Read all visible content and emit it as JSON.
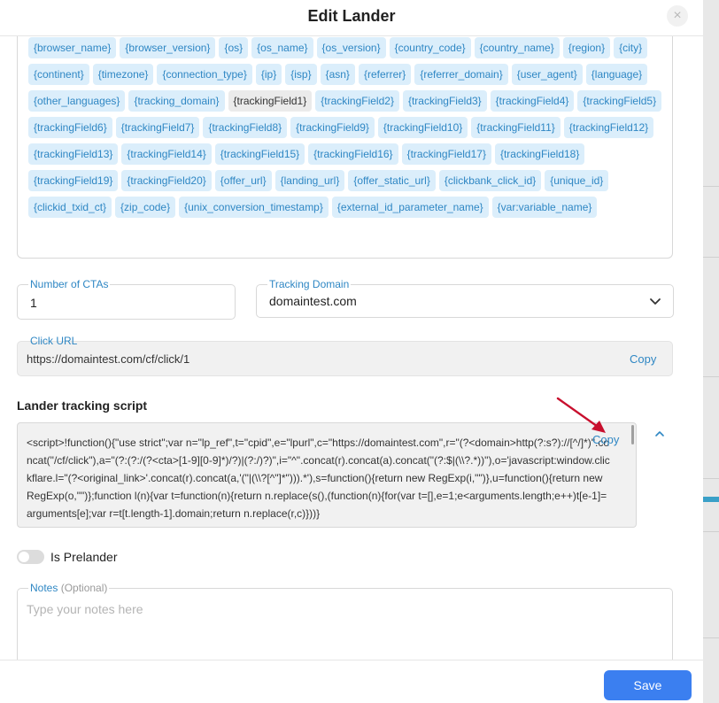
{
  "modal": {
    "title": "Edit Lander",
    "close_icon": "×"
  },
  "tokens": [
    {
      "label": "{browser_name}",
      "selected": false
    },
    {
      "label": "{browser_version}",
      "selected": false
    },
    {
      "label": "{os}",
      "selected": false
    },
    {
      "label": "{os_name}",
      "selected": false
    },
    {
      "label": "{os_version}",
      "selected": false
    },
    {
      "label": "{country_code}",
      "selected": false
    },
    {
      "label": "{country_name}",
      "selected": false
    },
    {
      "label": "{region}",
      "selected": false
    },
    {
      "label": "{city}",
      "selected": false
    },
    {
      "label": "{continent}",
      "selected": false
    },
    {
      "label": "{timezone}",
      "selected": false
    },
    {
      "label": "{connection_type}",
      "selected": false
    },
    {
      "label": "{ip}",
      "selected": false
    },
    {
      "label": "{isp}",
      "selected": false
    },
    {
      "label": "{asn}",
      "selected": false
    },
    {
      "label": "{referrer}",
      "selected": false
    },
    {
      "label": "{referrer_domain}",
      "selected": false
    },
    {
      "label": "{user_agent}",
      "selected": false
    },
    {
      "label": "{language}",
      "selected": false
    },
    {
      "label": "{other_languages}",
      "selected": false
    },
    {
      "label": "{tracking_domain}",
      "selected": false
    },
    {
      "label": "{trackingField1}",
      "selected": true
    },
    {
      "label": "{trackingField2}",
      "selected": false
    },
    {
      "label": "{trackingField3}",
      "selected": false
    },
    {
      "label": "{trackingField4}",
      "selected": false
    },
    {
      "label": "{trackingField5}",
      "selected": false
    },
    {
      "label": "{trackingField6}",
      "selected": false
    },
    {
      "label": "{trackingField7}",
      "selected": false
    },
    {
      "label": "{trackingField8}",
      "selected": false
    },
    {
      "label": "{trackingField9}",
      "selected": false
    },
    {
      "label": "{trackingField10}",
      "selected": false
    },
    {
      "label": "{trackingField11}",
      "selected": false
    },
    {
      "label": "{trackingField12}",
      "selected": false
    },
    {
      "label": "{trackingField13}",
      "selected": false
    },
    {
      "label": "{trackingField14}",
      "selected": false
    },
    {
      "label": "{trackingField15}",
      "selected": false
    },
    {
      "label": "{trackingField16}",
      "selected": false
    },
    {
      "label": "{trackingField17}",
      "selected": false
    },
    {
      "label": "{trackingField18}",
      "selected": false
    },
    {
      "label": "{trackingField19}",
      "selected": false
    },
    {
      "label": "{trackingField20}",
      "selected": false
    },
    {
      "label": "{offer_url}",
      "selected": false
    },
    {
      "label": "{landing_url}",
      "selected": false
    },
    {
      "label": "{offer_static_url}",
      "selected": false
    },
    {
      "label": "{clickbank_click_id}",
      "selected": false
    },
    {
      "label": "{unique_id}",
      "selected": false
    },
    {
      "label": "{clickid_txid_ct}",
      "selected": false
    },
    {
      "label": "{zip_code}",
      "selected": false
    },
    {
      "label": "{unix_conversion_timestamp}",
      "selected": false
    },
    {
      "label": "{external_id_parameter_name}",
      "selected": false
    },
    {
      "label": "{var:variable_name}",
      "selected": false
    }
  ],
  "ctas": {
    "label": "Number of CTAs",
    "value": "1"
  },
  "tracking_domain": {
    "label": "Tracking Domain",
    "value": "domaintest.com",
    "icon": "chevron-down-icon"
  },
  "click_url": {
    "label": "Click URL",
    "value": "https://domaintest.com/cf/click/1",
    "copy_label": "Copy"
  },
  "script": {
    "title": "Lander tracking script",
    "copy_label": "Copy",
    "text": "<script>!function(){\"use strict\";var n=\"lp_ref\",t=\"cpid\",e=\"lpurl\",c=\"https://domaintest.com\",r=\"(?<domain>http(?:s?)://[^/]*)\".concat(\"/cf/click\"),a=\"(?:(?:/(?<cta>[1-9][0-9]*)/?)|(?:/)?)\",i=\"^\".concat(r).concat(a).concat(\"(?:$|(\\\\?.*))\"),o='javascript:window.clickflare.l=\"(?<original_link>'.concat(r).concat(a,'(\"|(\\\\?[^\"]*\"))).*'),s=function(){return new RegExp(i,\"\")},u=function(){return new RegExp(o,\"\")};function l(n){var t=function(n){return n.replace(s(),(function(n){for(var t=[],e=1;e<arguments.length;e++)t[e-1]=arguments[e];var r=t[t.length-1].domain;return n.replace(r,c)}))}",
    "collapse_icon": "chevron-up-icon"
  },
  "prelander": {
    "label": "Is Prelander",
    "on": false
  },
  "notes": {
    "label": "Notes",
    "optional": "(Optional)",
    "placeholder": "Type your notes here"
  },
  "footer": {
    "save_label": "Save",
    "save_color": "#3b7ff0"
  },
  "accent_color": "#2f87c4"
}
